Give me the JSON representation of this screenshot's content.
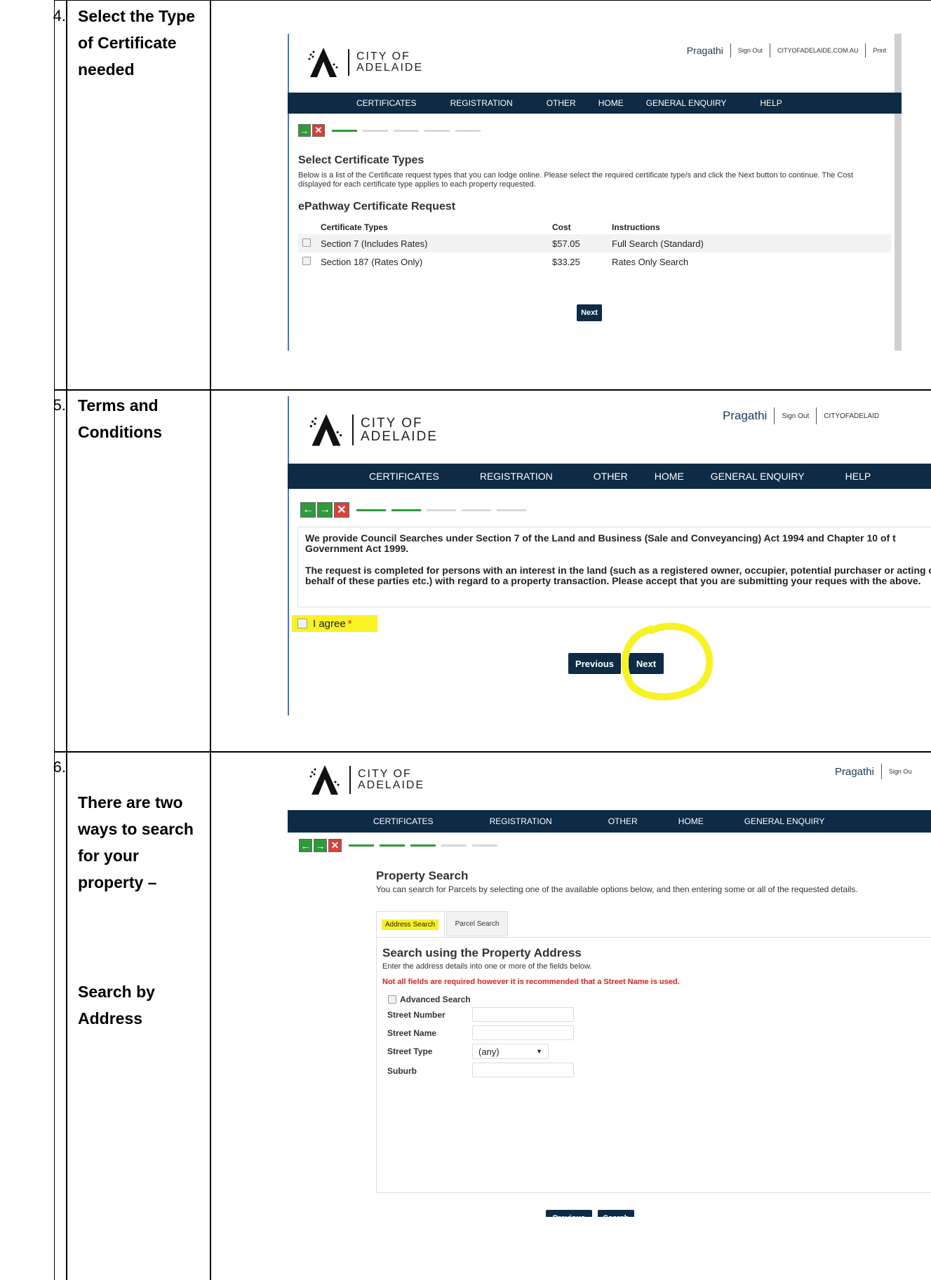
{
  "steps": [
    {
      "number": "4.",
      "title": "Select the Type of Certificate needed",
      "screen": {
        "brand_line1": "CITY OF",
        "brand_line2": "ADELAIDE",
        "user": "Pragathi",
        "sign_out": "Sign Out",
        "site_link": "CITYOFADELAIDE.COM.AU",
        "print": "Print",
        "nav": [
          "CERTIFICATES",
          "REGISTRATION",
          "OTHER",
          "HOME",
          "GENERAL ENQUIRY",
          "HELP"
        ],
        "heading": "Select Certificate Types",
        "intro": "Below is a list of the Certificate request types that you can lodge online. Please select the required certificate type/s and click the Next button to continue. The Cost displayed for each certificate type applies to each property requested.",
        "subheading": "ePathway Certificate Request",
        "table_headers": [
          "Certificate Types",
          "Cost",
          "Instructions"
        ],
        "rows": [
          {
            "type": "Section 7 (Includes Rates)",
            "cost": "$57.05",
            "instructions": "Full Search (Standard)"
          },
          {
            "type": "Section 187 (Rates Only)",
            "cost": "$33.25",
            "instructions": "Rates Only Search"
          }
        ],
        "next": "Next"
      }
    },
    {
      "number": "5.",
      "title": "Terms and Conditions",
      "screen": {
        "brand_line1": "CITY OF",
        "brand_line2": "ADELAIDE",
        "user": "Pragathi",
        "sign_out": "Sign Out",
        "site_link": "CITYOFADELAID",
        "nav": [
          "CERTIFICATES",
          "REGISTRATION",
          "OTHER",
          "HOME",
          "GENERAL ENQUIRY",
          "HELP"
        ],
        "para1": "We provide Council Searches under Section 7 of the Land and Business (Sale and Conveyancing) Act 1994 and Chapter 10 of t Government Act 1999.",
        "para2": "The request is completed for persons with an interest in the land (such as a registered owner, occupier, potential purchaser or acting on behalf of these parties etc.) with regard to a property transaction. Please accept that you are submitting your reques with the above.",
        "agree": "I agree",
        "required_mark": "*",
        "previous": "Previous",
        "next": "Next"
      }
    },
    {
      "number": "6.",
      "title": "There are two ways to search for your property –",
      "title2": "Search by Address",
      "screen": {
        "brand_line1": "CITY OF",
        "brand_line2": "ADELAIDE",
        "user": "Pragathi",
        "sign_out": "Sign Ou",
        "nav": [
          "CERTIFICATES",
          "REGISTRATION",
          "OTHER",
          "HOME",
          "GENERAL ENQUIRY"
        ],
        "heading": "Property Search",
        "intro": "You can search for Parcels by selecting one of the available options below, and then entering some or all of the requested details.",
        "tabs": [
          "Address Search",
          "Parcel Search"
        ],
        "section_title": "Search using the Property Address",
        "section_intro": "Enter the address details into one or more of the fields below.",
        "warning": "Not all fields are required however it is recommended that a Street Name is used.",
        "advanced": "Advanced Search",
        "fields": [
          "Street Number",
          "Street Name",
          "Street Type",
          "Suburb"
        ],
        "street_type_value": "(any)",
        "previous": "Previous",
        "search": "Search"
      }
    }
  ],
  "colors": {
    "navy": "#0d2b45",
    "green": "#2e9a3a",
    "red": "#d9413a",
    "highlight": "#f7f224",
    "warning": "#e02020"
  }
}
